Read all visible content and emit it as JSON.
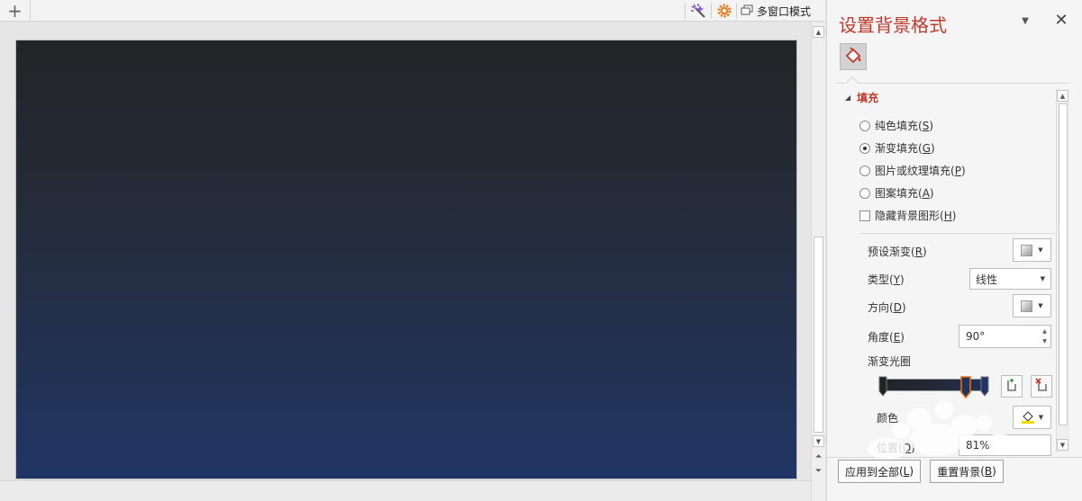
{
  "topbar": {
    "new_tab_glyph": "+",
    "icons": [
      "magic-wand-icon",
      "gear-icon",
      "multi-window-icon"
    ],
    "multi_window_label": "多窗口模式"
  },
  "slide": {
    "background_gradient": [
      "#232427",
      "#223358",
      "#213565"
    ]
  },
  "pane": {
    "title": "设置背景格式",
    "tab_icon": "paint-bucket-icon",
    "section_label": "填充",
    "fill_options": [
      {
        "label": "纯色填充",
        "key": "S",
        "selected": false
      },
      {
        "label": "渐变填充",
        "key": "G",
        "selected": true
      },
      {
        "label": "图片或纹理填充",
        "key": "P",
        "selected": false
      },
      {
        "label": "图案填充",
        "key": "A",
        "selected": false
      }
    ],
    "hide_graphics": {
      "label": "隐藏背景图形",
      "key": "H",
      "checked": false
    },
    "preset_label": "预设渐变",
    "preset_key": "R",
    "type_label": "类型",
    "type_key": "Y",
    "type_value": "线性",
    "direction_label": "方向",
    "direction_key": "D",
    "angle_label": "角度",
    "angle_key": "E",
    "angle_value": "90°",
    "stops_label": "渐变光圈",
    "color_label": "颜色",
    "position_label": "位置",
    "position_key": "O",
    "position_value": "81%",
    "apply_all_label": "应用到全部",
    "apply_all_key": "L",
    "reset_label": "重置背景",
    "reset_key": "B"
  },
  "watermark": {
    "text": "jingyan.baidu.com"
  },
  "colors": {
    "accent": "#c0392b",
    "stop_selected": "#e0701c"
  }
}
